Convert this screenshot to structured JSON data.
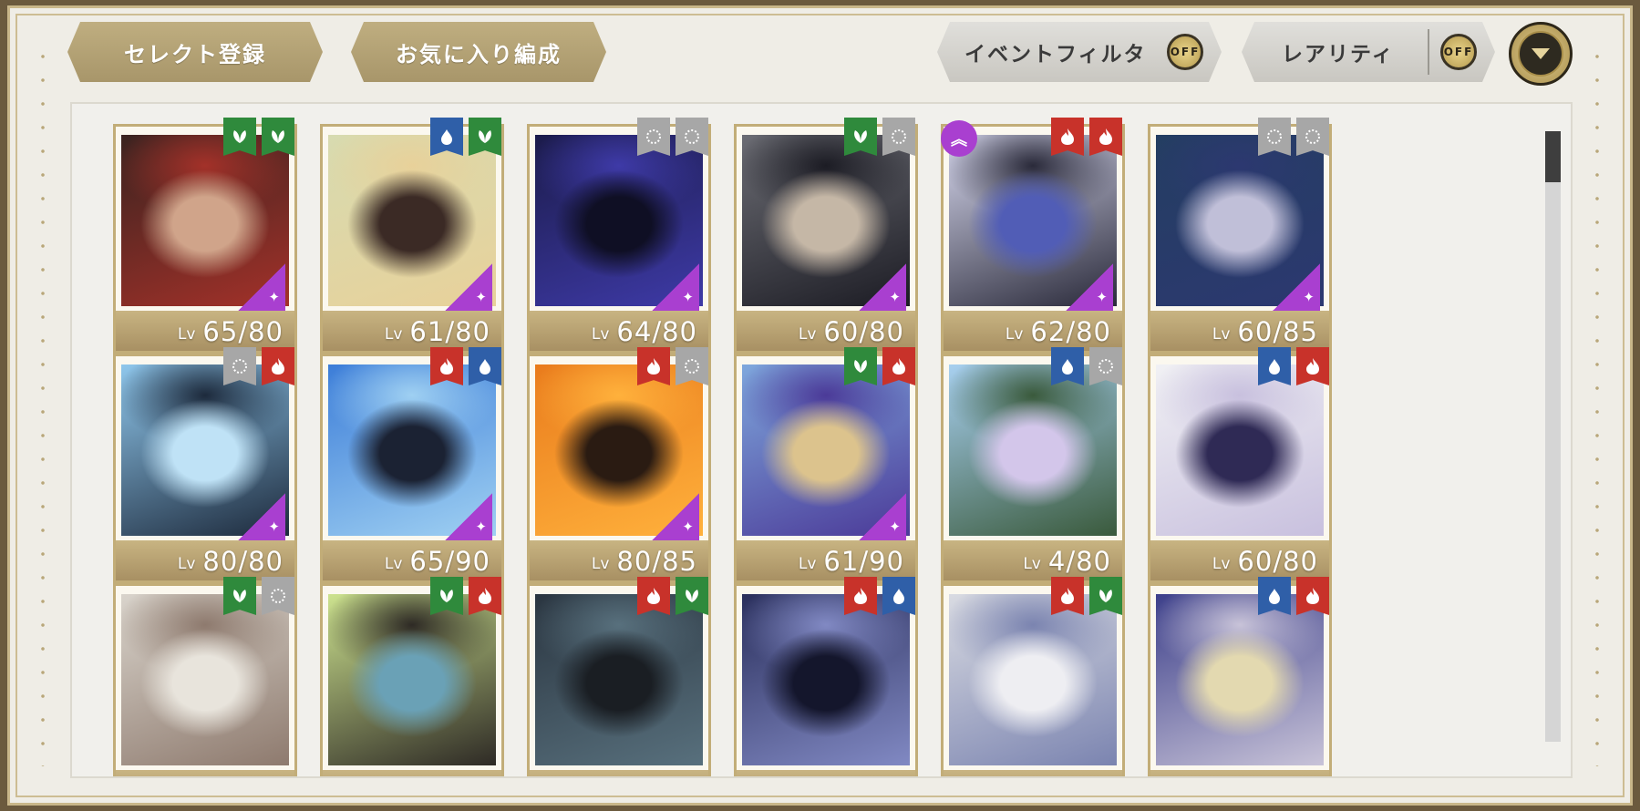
{
  "toolbar": {
    "select_register": "セレクト登録",
    "favorite_formation": "お気に入り編成",
    "event_filter": "イベントフィルタ",
    "rarity": "レアリティ",
    "event_filter_state": "OFF",
    "rarity_state": "OFF",
    "dropdown_icon": "chevron-down-icon"
  },
  "colors": {
    "green": "#2f8a3c",
    "red": "#c8322a",
    "blue": "#2f5fa8",
    "gray": "#a7a7a7",
    "rarity_badge": "#a93fd0"
  },
  "cards": [
    {
      "lv_prefix": "Lv",
      "level": "65/80",
      "attrs": [
        "green",
        "green"
      ],
      "art": [
        "#3a2320",
        "#a33129",
        "#d0a48a"
      ],
      "rarity_mark": true
    },
    {
      "lv_prefix": "Lv",
      "level": "61/80",
      "attrs": [
        "blue",
        "green"
      ],
      "art": [
        "#d7dbb0",
        "#e8d19a",
        "#3b2a25"
      ],
      "rarity_mark": true
    },
    {
      "lv_prefix": "Lv",
      "level": "64/80",
      "attrs": [
        "gray",
        "gray"
      ],
      "art": [
        "#1b1b4a",
        "#3e3aa7",
        "#0f0f24"
      ],
      "rarity_mark": true
    },
    {
      "lv_prefix": "Lv",
      "level": "60/80",
      "attrs": [
        "green",
        "gray"
      ],
      "art": [
        "#6c6d74",
        "#1c1c24",
        "#c5b7a6"
      ],
      "rarity_mark": true
    },
    {
      "lv_prefix": "Lv",
      "level": "62/80",
      "attrs": [
        "red",
        "red"
      ],
      "art": [
        "#d8d9ef",
        "#2a2a3a",
        "#515db6"
      ],
      "rarity_mark": true,
      "groove_icon": "up-chevron-icon"
    },
    {
      "lv_prefix": "Lv",
      "level": "60/85",
      "attrs": [
        "gray",
        "gray"
      ],
      "art": [
        "#243e62",
        "#2c3870",
        "#c0bfd8"
      ],
      "rarity_mark": true
    },
    {
      "lv_prefix": "Lv",
      "level": "80/80",
      "attrs": [
        "gray",
        "red"
      ],
      "art": [
        "#8fc7ec",
        "#1d2a3c",
        "#bfe2f6"
      ],
      "rarity_mark": true
    },
    {
      "lv_prefix": "Lv",
      "level": "65/90",
      "attrs": [
        "red",
        "blue"
      ],
      "art": [
        "#3c7dd8",
        "#9fd0f2",
        "#1b2233"
      ],
      "rarity_mark": true
    },
    {
      "lv_prefix": "Lv",
      "level": "80/85",
      "attrs": [
        "red",
        "gray"
      ],
      "art": [
        "#e97b1c",
        "#ffb13c",
        "#2a1b12"
      ],
      "rarity_mark": true
    },
    {
      "lv_prefix": "Lv",
      "level": "61/90",
      "attrs": [
        "green",
        "red"
      ],
      "art": [
        "#7fa8dd",
        "#4b3a98",
        "#dcc38d"
      ],
      "rarity_mark": true
    },
    {
      "lv_prefix": "Lv",
      "level": "4/80",
      "attrs": [
        "blue",
        "gray"
      ],
      "art": [
        "#a8d0f0",
        "#3a5a3c",
        "#d3c6ea"
      ],
      "rarity_mark": false
    },
    {
      "lv_prefix": "Lv",
      "level": "60/80",
      "attrs": [
        "blue",
        "red"
      ],
      "art": [
        "#f1f1f4",
        "#c8c0de",
        "#2f2a55"
      ],
      "rarity_mark": false
    },
    {
      "lv_prefix": "",
      "level": "",
      "attrs": [
        "green",
        "gray"
      ],
      "art": [
        "#d9d4cc",
        "#8e7a6e",
        "#e8e4dc"
      ],
      "rarity_mark": false
    },
    {
      "lv_prefix": "",
      "level": "",
      "attrs": [
        "green",
        "red"
      ],
      "art": [
        "#cde38f",
        "#2e2a25",
        "#6aa1b6"
      ],
      "rarity_mark": false
    },
    {
      "lv_prefix": "",
      "level": "",
      "attrs": [
        "red",
        "green"
      ],
      "art": [
        "#2a3540",
        "#58707d",
        "#1a1e23"
      ],
      "rarity_mark": false
    },
    {
      "lv_prefix": "",
      "level": "",
      "attrs": [
        "red",
        "blue"
      ],
      "art": [
        "#2a2f5c",
        "#8189c3",
        "#14162c"
      ],
      "rarity_mark": false
    },
    {
      "lv_prefix": "",
      "level": "",
      "attrs": [
        "red",
        "green"
      ],
      "art": [
        "#d9dbe2",
        "#7b84b0",
        "#eeeef2"
      ],
      "rarity_mark": false
    },
    {
      "lv_prefix": "",
      "level": "",
      "attrs": [
        "blue",
        "red"
      ],
      "art": [
        "#3c3f8a",
        "#c8c3d8",
        "#e3d9b0"
      ],
      "rarity_mark": false
    }
  ]
}
